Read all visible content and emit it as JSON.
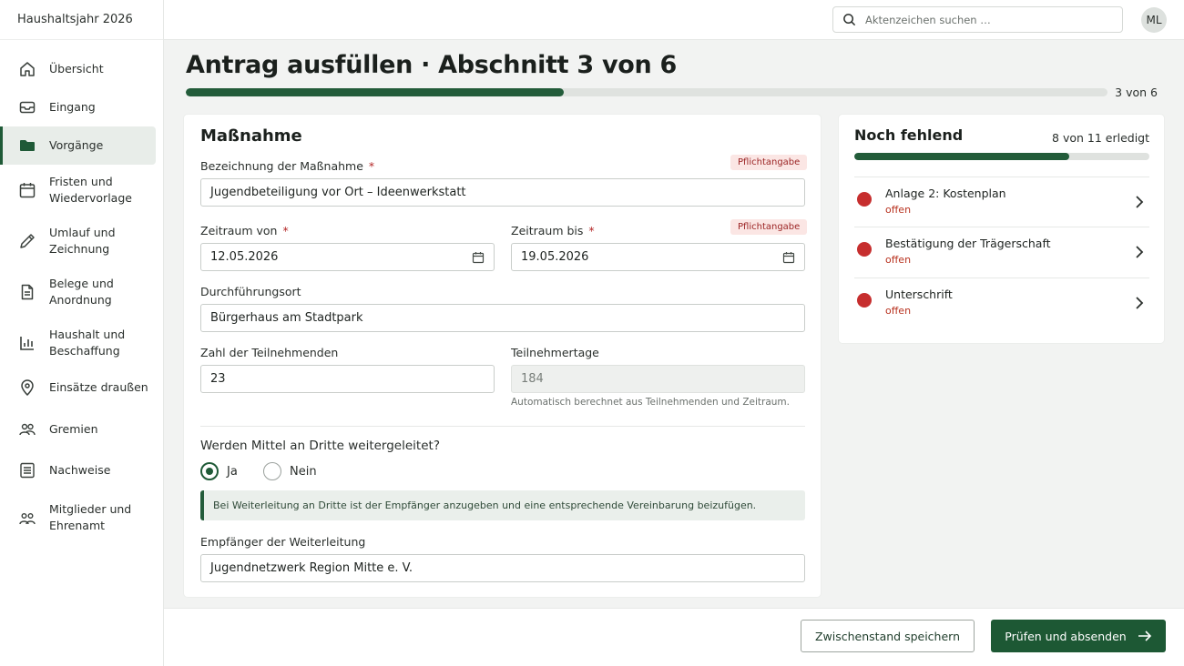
{
  "app": {
    "title": "Haushaltsjahr 2026"
  },
  "search": {
    "placeholder": "Aktenzeichen suchen …"
  },
  "user": {
    "initials": "ML"
  },
  "sidebar": {
    "items": [
      {
        "label": "Übersicht",
        "icon": "home-icon"
      },
      {
        "label": "Eingang",
        "icon": "inbox-icon"
      },
      {
        "label": "Vorgänge",
        "icon": "folder-icon",
        "active": true
      },
      {
        "label": "Fristen und\nWiedervorlage",
        "icon": "calendar-icon"
      },
      {
        "label": "Umlauf und\nZeichnung",
        "icon": "pen-icon"
      },
      {
        "label": "Belege und\nAnordnung",
        "icon": "document-icon"
      },
      {
        "label": "Haushalt und\nBeschaffung",
        "icon": "bar-chart-icon"
      },
      {
        "label": "Einsätze draußen",
        "icon": "map-pin-icon"
      },
      {
        "label": "Gremien",
        "icon": "group-icon"
      },
      {
        "label": "Nachweise",
        "icon": "checklist-icon"
      },
      {
        "label": "Mitglieder und\nEhrenamt",
        "icon": "people-icon"
      }
    ]
  },
  "header": {
    "title": "Antrag ausfüllen · Abschnitt 3 von 6",
    "progress_label": "3 von 6",
    "progress_step": 3,
    "progress_total": 6
  },
  "form": {
    "section_title": "Maßnahme",
    "required_mark": "*",
    "required_badge": "Pflichtangabe",
    "fields": {
      "bezeichnung": {
        "label": "Bezeichnung der Maßnahme",
        "value": "Jugendbeteiligung vor Ort – Ideenwerkstatt"
      },
      "zeitraum_von": {
        "label": "Zeitraum von",
        "value": "12.05.2026"
      },
      "zeitraum_bis": {
        "label": "Zeitraum bis",
        "value": "19.05.2026"
      },
      "ort": {
        "label": "Durchführungsort",
        "value": "Bürgerhaus am Stadtpark"
      },
      "teilnehmende": {
        "label": "Zahl der Teilnehmenden",
        "value": "23"
      },
      "teilnehmertage": {
        "label": "Teilnehmertage",
        "value": "184",
        "hint": "Automatisch berechnet aus Teilnehmenden und Zeitraum."
      },
      "empfaenger": {
        "label": "Empfänger der Weiterleitung",
        "value": "Jugendnetzwerk Region Mitte e. V."
      }
    },
    "question": {
      "label": "Werden Mittel an Dritte weitergeleitet?",
      "options": [
        {
          "label": "Ja",
          "selected": true
        },
        {
          "label": "Nein",
          "selected": false
        }
      ]
    },
    "info": "Bei Weiterleitung an Dritte ist der Empfänger anzugeben und eine entsprechende Vereinbarung beizufügen."
  },
  "missing": {
    "title": "Noch fehlend",
    "count_label": "8 von 11 erledigt",
    "done": 8,
    "total": 11,
    "status_color": "#c62e2e",
    "items": [
      {
        "label": "Anlage 2: Kostenplan",
        "status": "offen"
      },
      {
        "label": "Bestätigung der Trägerschaft",
        "status": "offen"
      },
      {
        "label": "Unterschrift",
        "status": "offen"
      }
    ]
  },
  "footer": {
    "save_label": "Zwischenstand speichern",
    "submit_label": "Prüfen und absenden"
  },
  "colors": {
    "accent": "#1d5834",
    "error": "#c62e2e"
  }
}
